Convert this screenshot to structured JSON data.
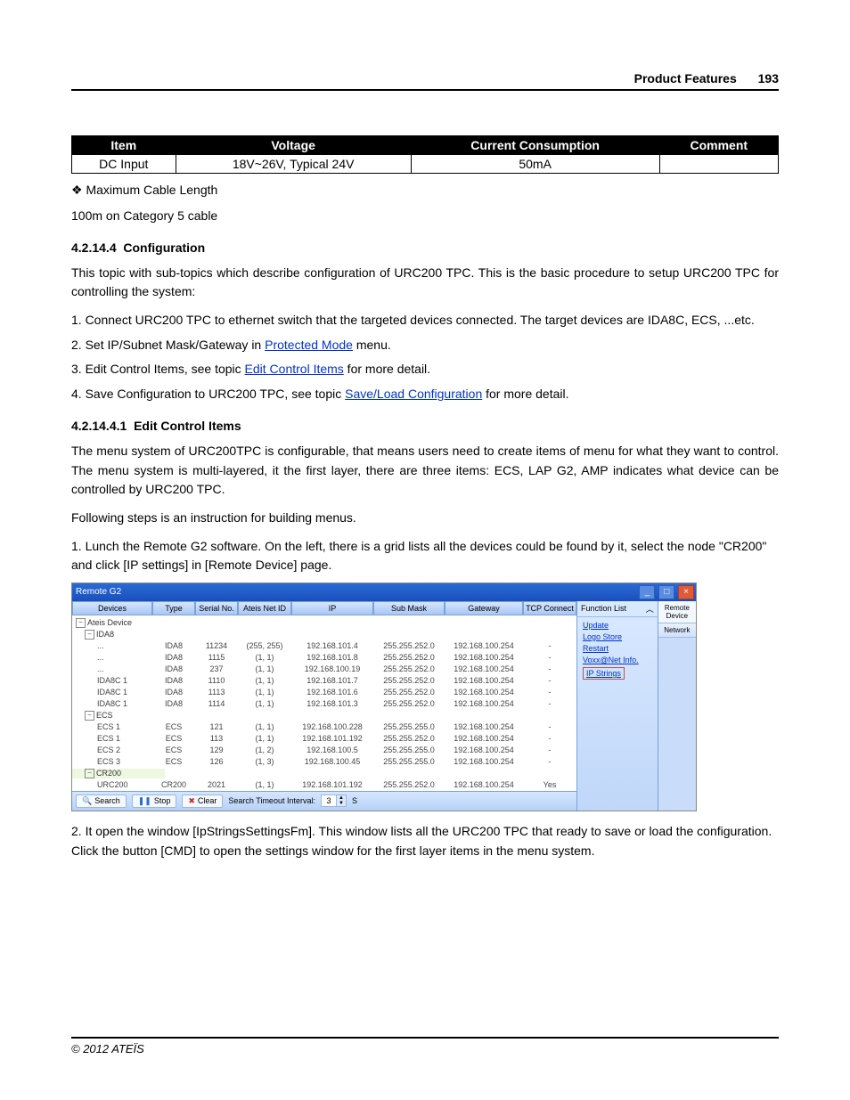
{
  "header": {
    "title": "Product Features",
    "page": "193"
  },
  "spec_table": {
    "headers": [
      "Item",
      "Voltage",
      "Current Consumption",
      "Comment"
    ],
    "row": {
      "item": "DC Input",
      "voltage": "18V~26V, Typical 24V",
      "current": "50mA",
      "comment": ""
    }
  },
  "bullet1": "Maximum Cable Length",
  "bullet1_sub": "100m on Category 5 cable",
  "sec_a": {
    "num": "4.2.14.4",
    "title": "Configuration"
  },
  "para_a": "This topic with sub-topics which describe configuration of URC200 TPC. This is the basic procedure to setup URC200 TPC for controlling the system:",
  "steps_a": {
    "s1": "1. Connect URC200 TPC to ethernet switch that the targeted devices connected. The target devices are IDA8C, ECS, ...etc.",
    "s2a": "2. Set IP/Subnet Mask/Gateway in ",
    "s2link": "Protected Mode",
    "s2b": " menu.",
    "s3a": "3. Edit Control Items, see topic ",
    "s3link": "Edit Control Items",
    "s3b": " for more detail.",
    "s4a": "4. Save Configuration to URC200 TPC, see topic ",
    "s4link": "Save/Load Configuration",
    "s4b": " for more detail."
  },
  "sec_b": {
    "num": "4.2.14.4.1",
    "title": "Edit Control Items"
  },
  "para_b1": "The menu system of URC200TPC is configurable, that means users need to create items of menu for what they want to control. The menu system is multi-layered, it the first layer, there are three items: ECS, LAP G2, AMP indicates what device can be controlled by URC200 TPC.",
  "para_b2": "Following steps is an instruction for building menus.",
  "steps_b": {
    "s1": "1. Lunch the Remote G2 software. On the left, there is a grid lists all the devices could be found by it, select the node \"CR200\" and click [IP settings] in [Remote Device] page.",
    "s2": "2. It open the window [IpStringsSettingsFm]. This window lists all the URC200 TPC that ready to save or load the configuration. Click the button [CMD] to open the settings window for the first layer items in the menu system."
  },
  "shot": {
    "title": "Remote G2",
    "cols": [
      "Devices",
      "Type",
      "Serial No.",
      "Ateis Net ID",
      "IP",
      "Sub Mask",
      "Gateway",
      "TCP Connect"
    ],
    "root": "Ateis Device",
    "groups": {
      "g1": "IDA8",
      "g2": "ECS",
      "g3": "CR200"
    },
    "rows": [
      {
        "dev": "...",
        "type": "IDA8",
        "ser": "11234",
        "net": "(255, 255)",
        "ip": "192.168.101.4",
        "sub": "255.255.252.0",
        "gw": "192.168.100.254",
        "tcp": "-"
      },
      {
        "dev": "...",
        "type": "IDA8",
        "ser": "1115",
        "net": "(1, 1)",
        "ip": "192.168.101.8",
        "sub": "255.255.252.0",
        "gw": "192.168.100.254",
        "tcp": "-"
      },
      {
        "dev": "...",
        "type": "IDA8",
        "ser": "237",
        "net": "(1, 1)",
        "ip": "192.168.100.19",
        "sub": "255.255.252.0",
        "gw": "192.168.100.254",
        "tcp": "-"
      },
      {
        "dev": "IDA8C 1",
        "type": "IDA8",
        "ser": "1110",
        "net": "(1, 1)",
        "ip": "192.168.101.7",
        "sub": "255.255.252.0",
        "gw": "192.168.100.254",
        "tcp": "-"
      },
      {
        "dev": "IDA8C 1",
        "type": "IDA8",
        "ser": "1113",
        "net": "(1, 1)",
        "ip": "192.168.101.6",
        "sub": "255.255.252.0",
        "gw": "192.168.100.254",
        "tcp": "-"
      },
      {
        "dev": "IDA8C 1",
        "type": "IDA8",
        "ser": "1114",
        "net": "(1, 1)",
        "ip": "192.168.101.3",
        "sub": "255.255.252.0",
        "gw": "192.168.100.254",
        "tcp": "-"
      },
      {
        "dev": "ECS 1",
        "type": "ECS",
        "ser": "121",
        "net": "(1, 1)",
        "ip": "192.168.100.228",
        "sub": "255.255.255.0",
        "gw": "192.168.100.254",
        "tcp": "-"
      },
      {
        "dev": "ECS 1",
        "type": "ECS",
        "ser": "113",
        "net": "(1, 1)",
        "ip": "192.168.101.192",
        "sub": "255.255.252.0",
        "gw": "192.168.100.254",
        "tcp": "-"
      },
      {
        "dev": "ECS 2",
        "type": "ECS",
        "ser": "129",
        "net": "(1, 2)",
        "ip": "192.168.100.5",
        "sub": "255.255.255.0",
        "gw": "192.168.100.254",
        "tcp": "-"
      },
      {
        "dev": "ECS 3",
        "type": "ECS",
        "ser": "126",
        "net": "(1, 3)",
        "ip": "192.168.100.45",
        "sub": "255.255.255.0",
        "gw": "192.168.100.254",
        "tcp": "-"
      },
      {
        "dev": "URC200",
        "type": "CR200",
        "ser": "2021",
        "net": "(1, 1)",
        "ip": "192.168.101.192",
        "sub": "255.255.252.0",
        "gw": "192.168.100.254",
        "tcp": "Yes"
      }
    ],
    "bottom": {
      "search": "Search",
      "stop": "Stop",
      "clear": "Clear",
      "interval_label": "Search Timeout Interval:",
      "interval_val": "3",
      "interval_unit": "S"
    },
    "right": {
      "header": "Function List",
      "links": [
        "Update",
        "Logo Store",
        "Restart",
        "Voxx@Net Info.",
        "IP Strings"
      ],
      "tabs": [
        "Remote Device",
        "Network"
      ]
    }
  },
  "footer": "© 2012 ATEÏS"
}
